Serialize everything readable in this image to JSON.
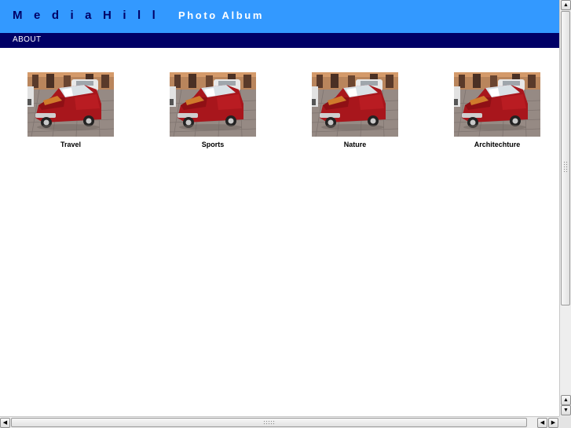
{
  "header": {
    "brand": "MediaHill",
    "subtitle": "Photo Album"
  },
  "nav": {
    "items": [
      {
        "label": "ABOUT"
      }
    ]
  },
  "gallery": {
    "albums": [
      {
        "label": "Travel"
      },
      {
        "label": "Sports"
      },
      {
        "label": "Nature"
      },
      {
        "label": "Architechture"
      }
    ]
  },
  "colors": {
    "header_bg": "#3399ff",
    "brand_text": "#000066",
    "navbar_bg": "#000066",
    "car_red": "#a8161c"
  },
  "icons": {
    "thumbnail": "red-car-photo",
    "scroll_up": "arrow-up-icon",
    "scroll_down": "arrow-down-icon",
    "scroll_left": "arrow-left-icon",
    "scroll_right": "arrow-right-icon"
  }
}
